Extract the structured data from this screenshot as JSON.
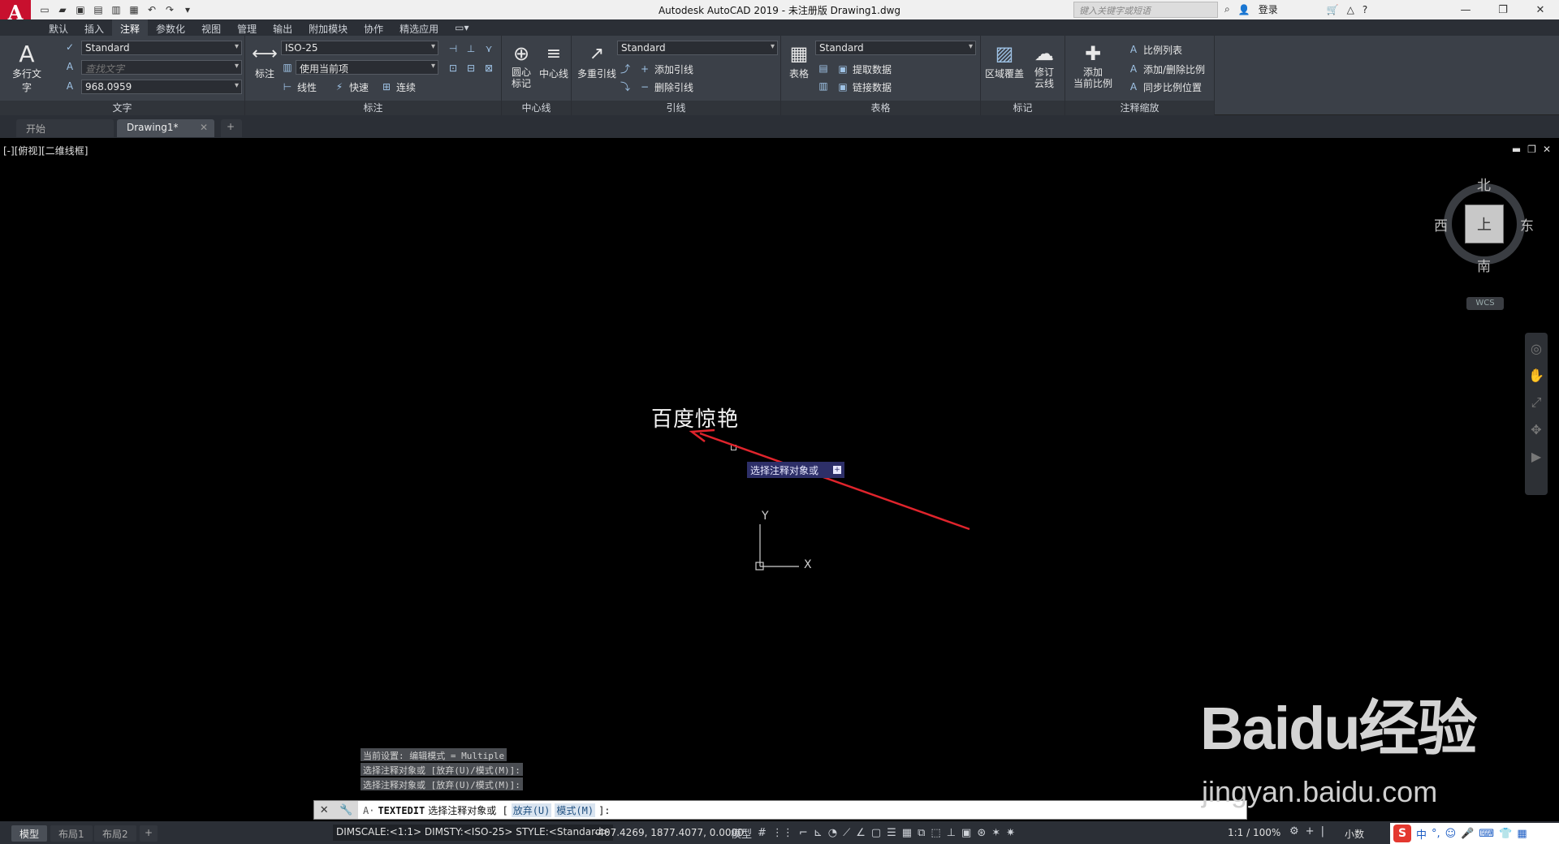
{
  "app": {
    "window_title": "Autodesk AutoCAD 2019 - 未注册版    Drawing1.dwg",
    "logo_letter": "A",
    "search_placeholder": "键入关键字或短语",
    "signin_label": "登录"
  },
  "ribbon_tabs": [
    "默认",
    "插入",
    "注释",
    "参数化",
    "视图",
    "管理",
    "输出",
    "附加模块",
    "协作",
    "精选应用"
  ],
  "active_ribbon_tab": "注释",
  "ribbon": {
    "text_panel": {
      "title": "文字",
      "mtext_label": "多行文字",
      "style_value": "Standard",
      "find_placeholder": "查找文字",
      "height_value": "968.0959"
    },
    "dim_panel": {
      "title": "标注",
      "dim_button": "标注",
      "style_value": "ISO-25",
      "layer_value": "使用当前项",
      "linear_label": "线性",
      "quick_label": "快速",
      "continue_label": "连续"
    },
    "centerline_panel": {
      "title": "中心线",
      "center_mark_label": "圆心\n标记",
      "centerline_label": "中心线"
    },
    "leader_panel": {
      "title": "引线",
      "mleader_label": "多重引线",
      "style_value": "Standard",
      "add_leader": "添加引线",
      "remove_leader": "删除引线"
    },
    "table_panel": {
      "title": "表格",
      "table_label": "表格",
      "style_value": "Standard",
      "extract_label": "提取数据",
      "link_label": "链接数据"
    },
    "markup_panel": {
      "title": "标记",
      "wipeout_label": "区域覆盖",
      "revcloud_label": "修订\n云线"
    },
    "scale_panel": {
      "title": "注释缩放",
      "add_scale_label": "添加\n当前比例",
      "scale_list": "比例列表",
      "add_delete_scale": "添加/删除比例",
      "sync_scale": "同步比例位置"
    }
  },
  "doc_tabs": [
    {
      "label": "开始",
      "active": false
    },
    {
      "label": "Drawing1*",
      "active": true
    }
  ],
  "viewport": {
    "label": "[-][俯视][二维线框]"
  },
  "viewcube": {
    "north": "北",
    "south": "南",
    "east": "东",
    "west": "西",
    "face": "上",
    "wcs": "WCS"
  },
  "drawing": {
    "text_object": "百度惊艳",
    "tooltip": "选择注释对象或",
    "ucs_x": "X",
    "ucs_y": "Y"
  },
  "command_history": [
    "当前设置: 编辑模式 = Multiple",
    "选择注释对象或 [放弃(U)/模式(M)]:",
    "选择注释对象或 [放弃(U)/模式(M)]:"
  ],
  "command_line": {
    "command": "TEXTEDIT",
    "prompt": "选择注释对象或 [",
    "option_undo": "放弃(U)",
    "option_mode": "模式(M)",
    "suffix": "]:"
  },
  "layout_tabs": [
    {
      "label": "模型",
      "active": true
    },
    {
      "label": "布局1",
      "active": false
    },
    {
      "label": "布局2",
      "active": false
    }
  ],
  "status": {
    "info": "DIMSCALE:<1:1> DIMSTY:<ISO-25> STYLE:<Standard>",
    "coords": "-407.4269, 1877.4077, 0.0000",
    "model_label": "模型",
    "scale": "1:1 / 100%",
    "units": "小数"
  },
  "watermark": {
    "brand": "Baidu经验",
    "url": "jingyan.baidu.com"
  },
  "colors": {
    "accent_red": "#e0242c",
    "ribbon_bg": "#3b4048",
    "drawing_bg": "#000000"
  }
}
